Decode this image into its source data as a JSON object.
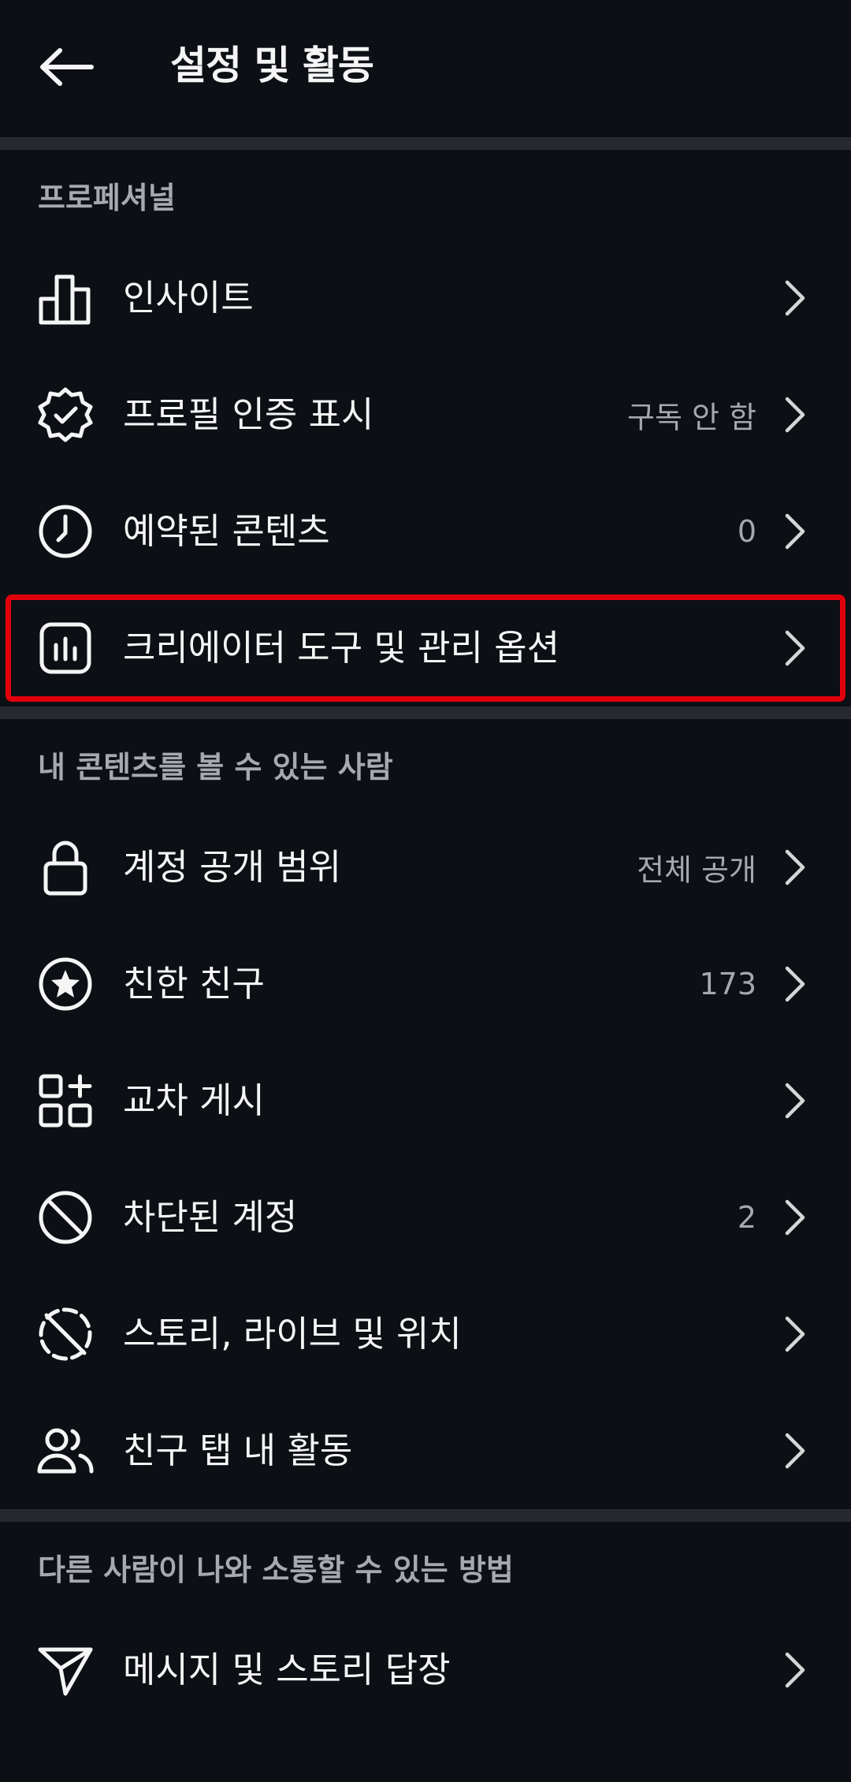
{
  "header": {
    "title": "설정 및 활동",
    "back_icon": "arrow-left-icon"
  },
  "sections": [
    {
      "title": "프로페셔널",
      "items": [
        {
          "label": "인사이트",
          "value": "",
          "icon": "bar-chart-icon"
        },
        {
          "label": "프로필 인증 표시",
          "value": "구독 안 함",
          "icon": "verified-badge-icon"
        },
        {
          "label": "예약된 콘텐츠",
          "value": "0",
          "icon": "clock-icon"
        },
        {
          "label": "크리에이터 도구 및 관리 옵션",
          "value": "",
          "icon": "creator-tools-icon",
          "highlighted": true
        }
      ]
    },
    {
      "title": "내 콘텐츠를 볼 수 있는 사람",
      "items": [
        {
          "label": "계정 공개 범위",
          "value": "전체 공개",
          "icon": "lock-icon"
        },
        {
          "label": "친한 친구",
          "value": "173",
          "icon": "star-circle-icon"
        },
        {
          "label": "교차 게시",
          "value": "",
          "icon": "grid-plus-icon"
        },
        {
          "label": "차단된 계정",
          "value": "2",
          "icon": "block-icon"
        },
        {
          "label": "스토리, 라이브 및 위치",
          "value": "",
          "icon": "story-off-icon"
        },
        {
          "label": "친구 탭 내 활동",
          "value": "",
          "icon": "people-icon"
        }
      ]
    },
    {
      "title": "다른 사람이 나와 소통할 수 있는 방법",
      "items": [
        {
          "label": "메시지 및 스토리 답장",
          "value": "",
          "icon": "send-icon"
        }
      ]
    }
  ],
  "colors": {
    "background": "#0c0f14",
    "divider": "#262a30",
    "highlight": "#e0000b",
    "secondary_text": "#a5a8ad"
  }
}
